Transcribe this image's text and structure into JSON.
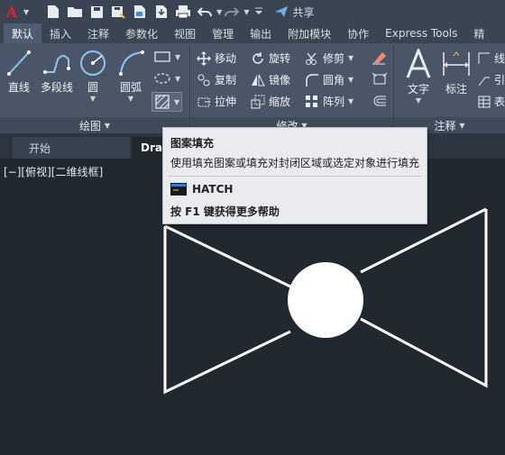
{
  "quick_access": {
    "app_logo": "A",
    "share_label": "共享"
  },
  "ribbon_tabs": [
    "默认",
    "插入",
    "注释",
    "参数化",
    "视图",
    "管理",
    "输出",
    "附加模块",
    "协作",
    "Express Tools",
    "精"
  ],
  "ribbon": {
    "draw": {
      "line": "直线",
      "polyline": "多段线",
      "circle": "圆",
      "arc": "圆弧",
      "panel_label": "绘图"
    },
    "modify": {
      "move": "移动",
      "rotate": "旋转",
      "trim": "修剪",
      "copy": "复制",
      "mirror": "镜像",
      "fillet": "圆角",
      "stretch": "拉伸",
      "scale": "缩放",
      "array": "阵列",
      "panel_label": "修改"
    },
    "annotation": {
      "text": "文字",
      "dimension": "标注",
      "linear": "线",
      "leader": "引",
      "table": "表",
      "panel_label": "注释"
    }
  },
  "doc_tabs": {
    "start": "开始",
    "drawing": "Draw"
  },
  "viewport_label": "[−][俯视][二维线框]",
  "tooltip": {
    "title": "图案填充",
    "description": "使用填充图案或填充对封闭区域或选定对象进行填充",
    "command": "HATCH",
    "help": "按 F1 键获得更多帮助"
  },
  "colors": {
    "background": "#212830",
    "ribbon": "#4a5668",
    "accent": "#e0242f",
    "tooltip_bg": "#e9ebee"
  },
  "icons": [
    "autocad-logo-icon",
    "new-file-icon",
    "open-folder-icon",
    "save-icon",
    "save-as-icon",
    "web-mobile-icon",
    "plot-icon",
    "undo-icon",
    "redo-icon",
    "share-icon",
    "line-icon",
    "polyline-icon",
    "circle-icon",
    "arc-icon",
    "rectangle-icon",
    "ellipse-icon",
    "hatch-icon",
    "move-icon",
    "rotate-icon",
    "trim-icon",
    "copy-icon",
    "mirror-icon",
    "fillet-icon",
    "stretch-icon",
    "scale-icon",
    "array-icon",
    "text-icon",
    "dimension-icon",
    "table-icon"
  ]
}
